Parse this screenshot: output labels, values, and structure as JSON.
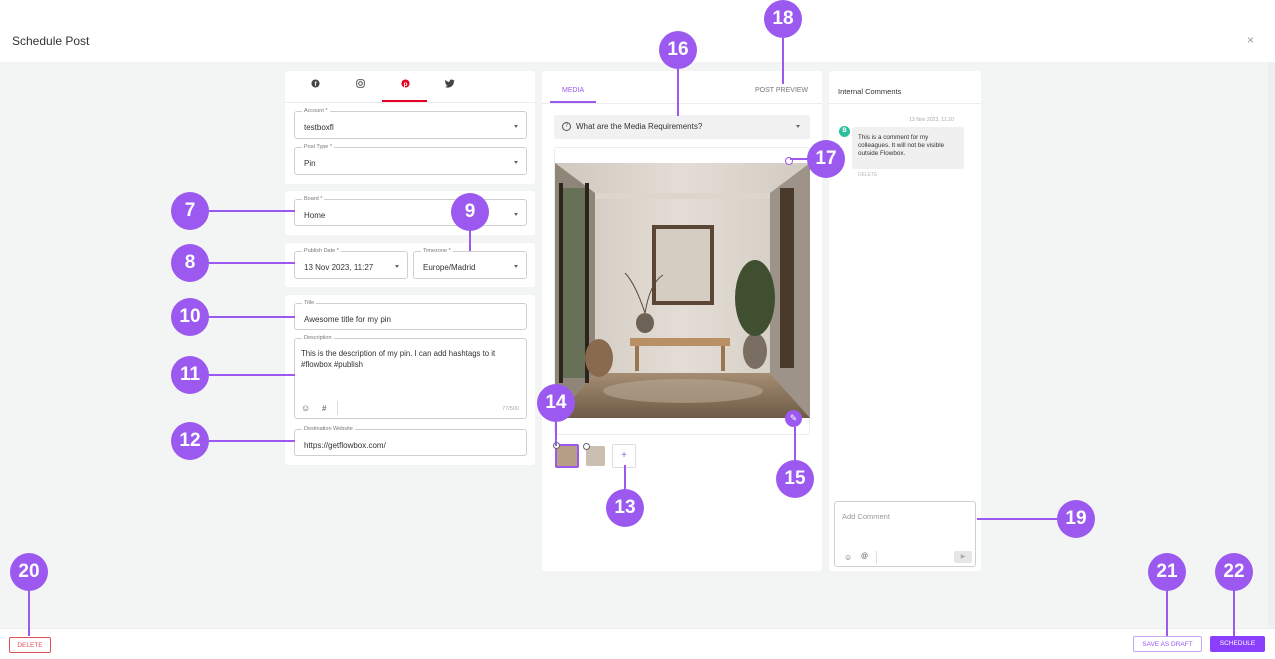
{
  "header": {
    "title": "Schedule Post",
    "close_icon": "×"
  },
  "social_tabs": [
    {
      "icon": "facebook-icon",
      "glyph": "●"
    },
    {
      "icon": "instagram-icon",
      "glyph": "◎"
    },
    {
      "icon": "pinterest-icon",
      "glyph": "●"
    },
    {
      "icon": "twitter-icon",
      "glyph": "✦"
    }
  ],
  "form": {
    "account": {
      "label": "Account *",
      "value": "testboxfl"
    },
    "post_type": {
      "label": "Post Type *",
      "value": "Pin"
    },
    "board": {
      "label": "Board *",
      "value": "Home"
    },
    "publish_date": {
      "label": "Publish Date *",
      "value": "13 Nov 2023, 11:27"
    },
    "timezone": {
      "label": "Timezone *",
      "value": "Europe/Madrid"
    },
    "title": {
      "label": "Title",
      "value": "Awesome title for my pin"
    },
    "description": {
      "label": "Description",
      "value": "This is the description of my pin. I can add hashtags to it #flowbox #publish",
      "counter": "77/500"
    },
    "destination": {
      "label": "Destination Website",
      "value": "https://getflowbox.com/"
    }
  },
  "media": {
    "tab_media": "MEDIA",
    "tab_preview": "POST PREVIEW",
    "requirements": "What are the Media Requirements?",
    "add_glyph": "+"
  },
  "comments": {
    "title": "Internal Comments",
    "timestamp": "13 Nov 2023, 11:20",
    "avatar_initial": "B",
    "text": "This is a comment for my colleagues. It will not be visible outside Flowbox.",
    "delete_label": "DELETE",
    "placeholder": "Add Comment"
  },
  "footer": {
    "delete": "DELETE",
    "draft": "SAVE AS DRAFT",
    "schedule": "SCHEDULE"
  },
  "annotations": [
    "7",
    "8",
    "9",
    "10",
    "11",
    "12",
    "13",
    "14",
    "15",
    "16",
    "17",
    "18",
    "19",
    "20",
    "21",
    "22"
  ],
  "colors": {
    "accent": "#9b59f0",
    "pinterest": "#e60023",
    "danger": "#e0505a"
  }
}
